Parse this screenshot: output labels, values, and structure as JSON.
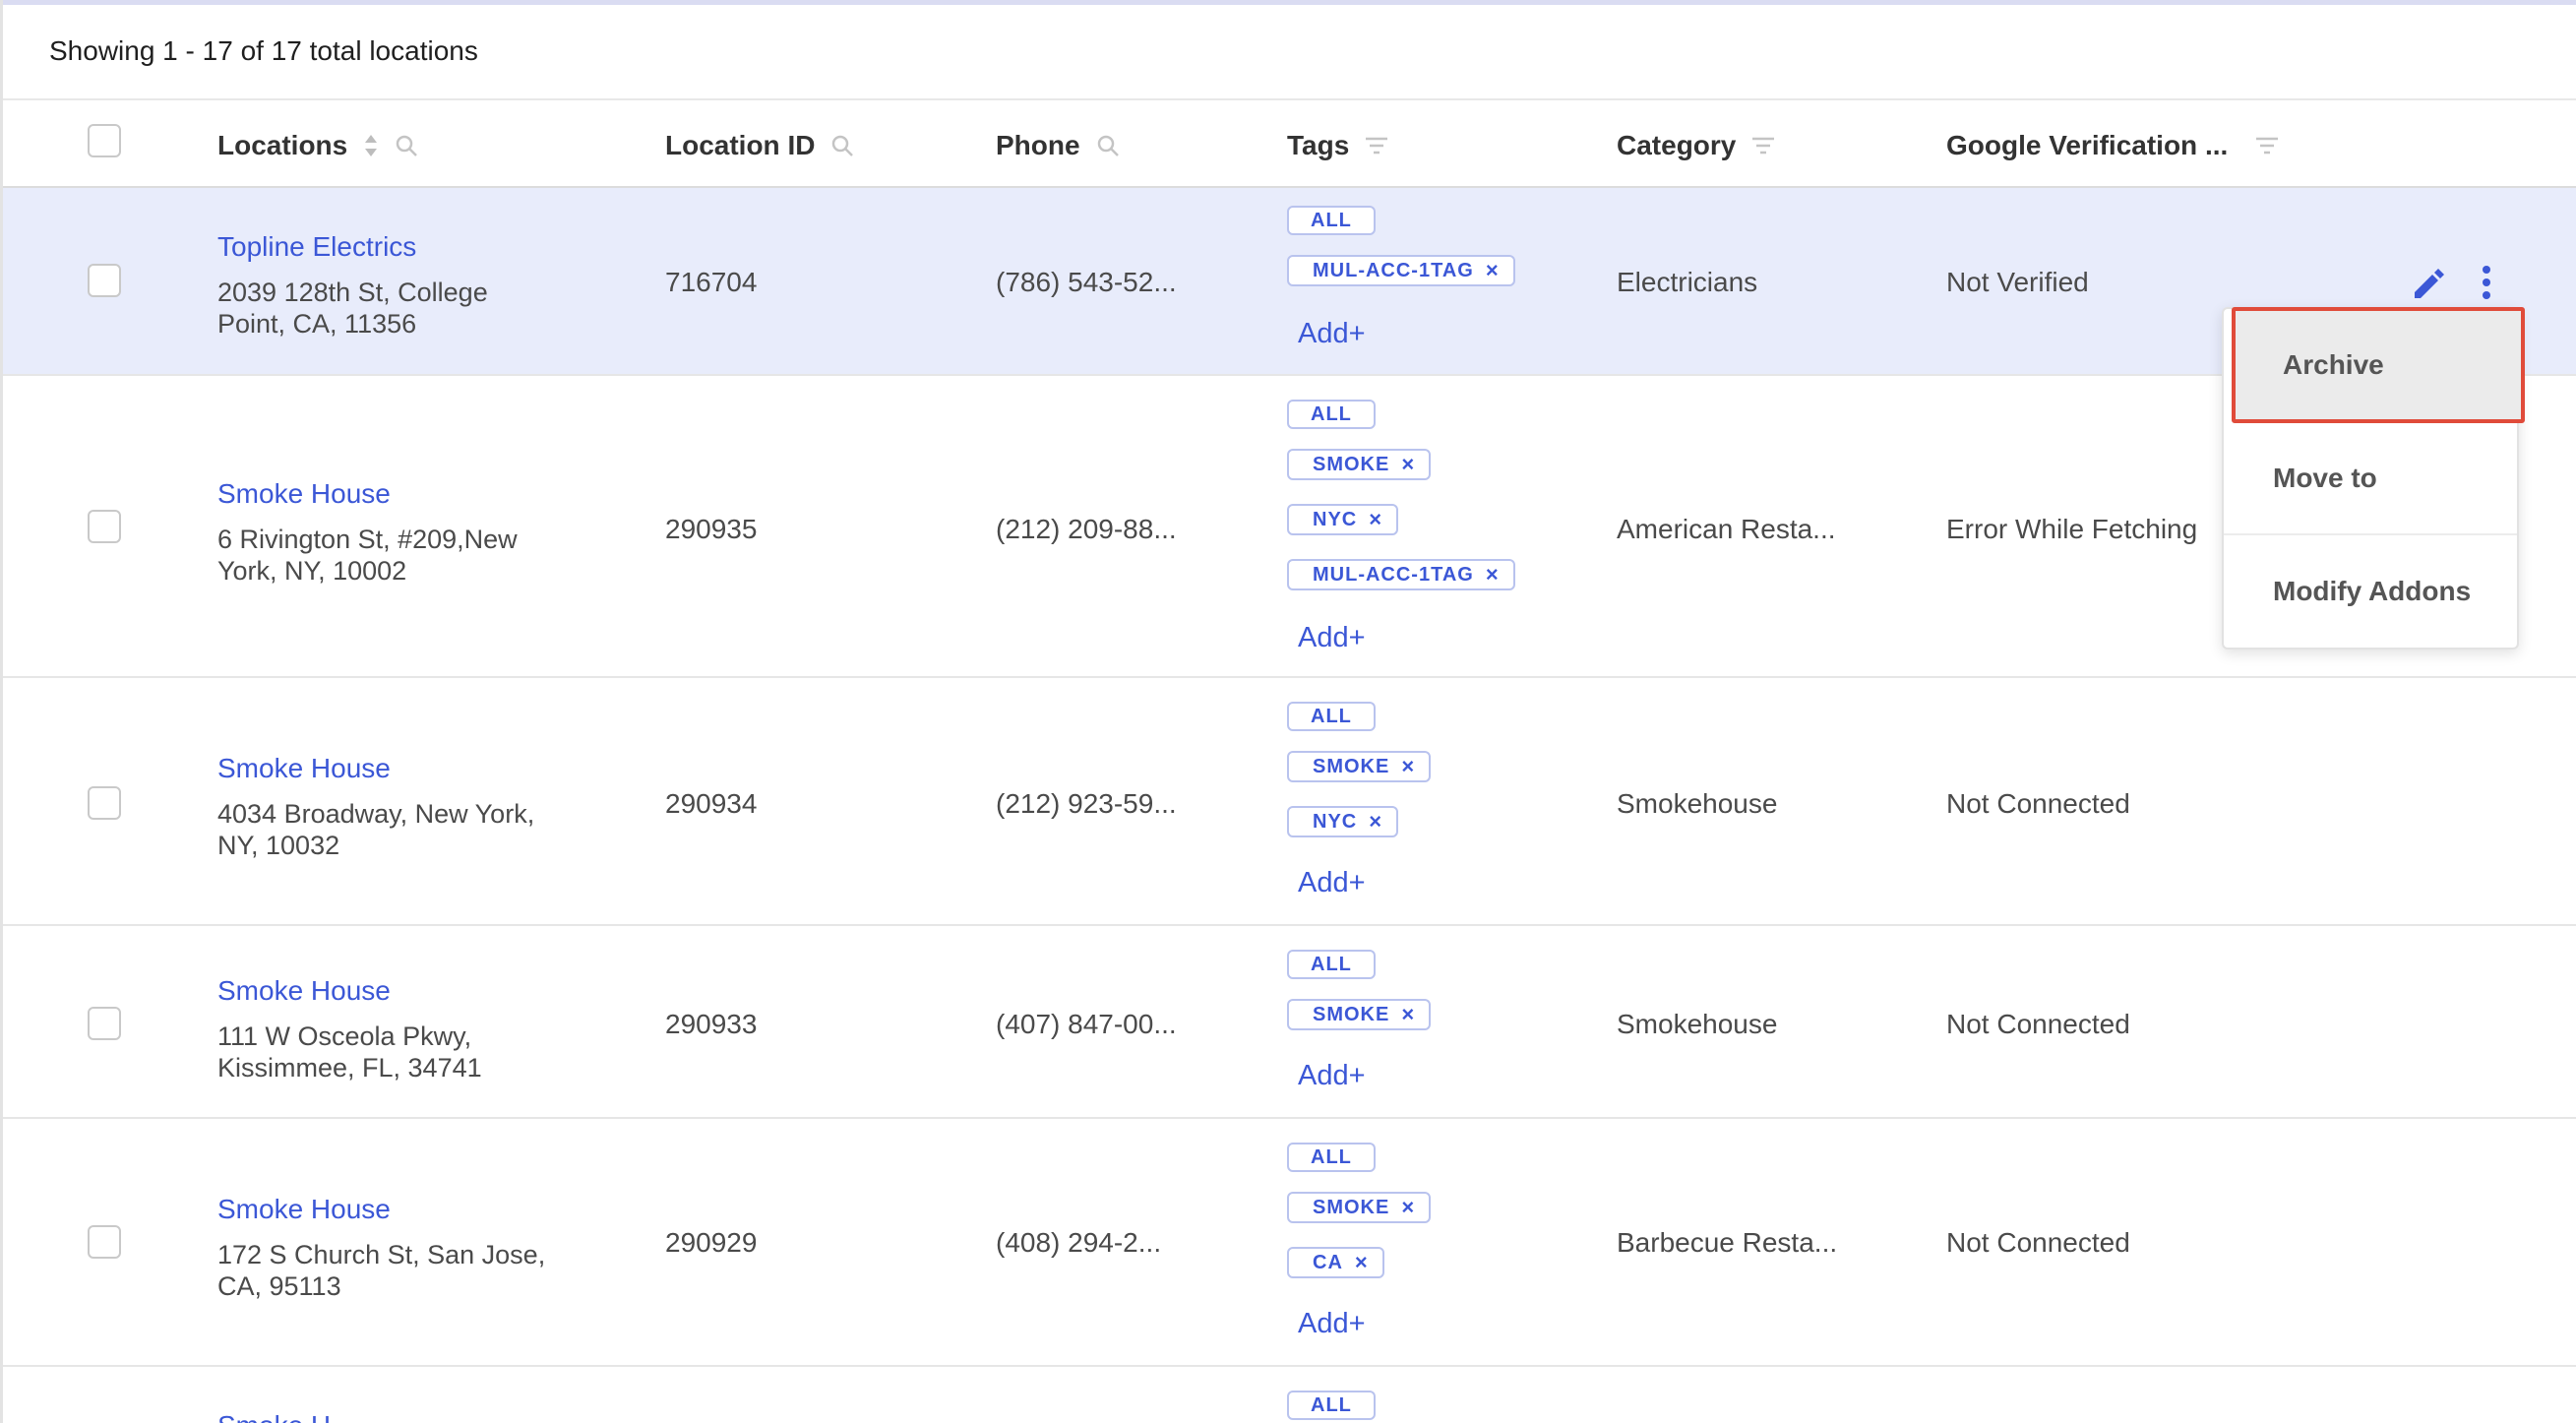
{
  "summary": "Showing 1 - 17 of 17 total locations",
  "columns": {
    "locations": "Locations",
    "location_id": "Location ID",
    "phone": "Phone",
    "tags": "Tags",
    "category": "Category",
    "google_verification": "Google Verification ..."
  },
  "add_label": "Add+",
  "rows": [
    {
      "name": "Topline Electrics",
      "address_line1": "2039 128th St, College",
      "address_line2": "Point, CA, 11356",
      "id": "716704",
      "phone": "(786) 543-52...",
      "tags": [
        "ALL",
        "MUL-ACC-1TAG"
      ],
      "category": "Electricians",
      "verification": "Not Verified",
      "selected": true
    },
    {
      "name": "Smoke House",
      "address_line1": "6 Rivington St, #209,New",
      "address_line2": "York, NY, 10002",
      "id": "290935",
      "phone": "(212) 209-88...",
      "tags": [
        "ALL",
        "SMOKE",
        "NYC",
        "MUL-ACC-1TAG"
      ],
      "category": "American Resta...",
      "verification": "Error While Fetching",
      "selected": false
    },
    {
      "name": "Smoke House",
      "address_line1": "4034 Broadway, New York,",
      "address_line2": "NY, 10032",
      "id": "290934",
      "phone": "(212) 923-59...",
      "tags": [
        "ALL",
        "SMOKE",
        "NYC"
      ],
      "category": "Smokehouse",
      "verification": "Not Connected",
      "selected": false
    },
    {
      "name": "Smoke House",
      "address_line1": "111 W Osceola Pkwy,",
      "address_line2": "Kissimmee, FL, 34741",
      "id": "290933",
      "phone": "(407) 847-00...",
      "tags": [
        "ALL",
        "SMOKE"
      ],
      "category": "Smokehouse",
      "verification": "Not Connected",
      "selected": false
    },
    {
      "name": "Smoke House",
      "address_line1": "172 S Church St, San Jose,",
      "address_line2": "CA, 95113",
      "id": "290929",
      "phone": "(408) 294-2...",
      "tags": [
        "ALL",
        "SMOKE",
        "CA"
      ],
      "category": "Barbecue Resta...",
      "verification": "Not Connected",
      "selected": false
    },
    {
      "name": "Smoke H...",
      "tags": [
        "ALL"
      ]
    }
  ],
  "menu": {
    "items": [
      "Archive",
      "Move to",
      "Modify Addons"
    ],
    "active": "Archive"
  },
  "colors": {
    "accent": "#3b57d6",
    "selected_row": "#e8ecfb",
    "highlight_border": "#e04b3a"
  }
}
